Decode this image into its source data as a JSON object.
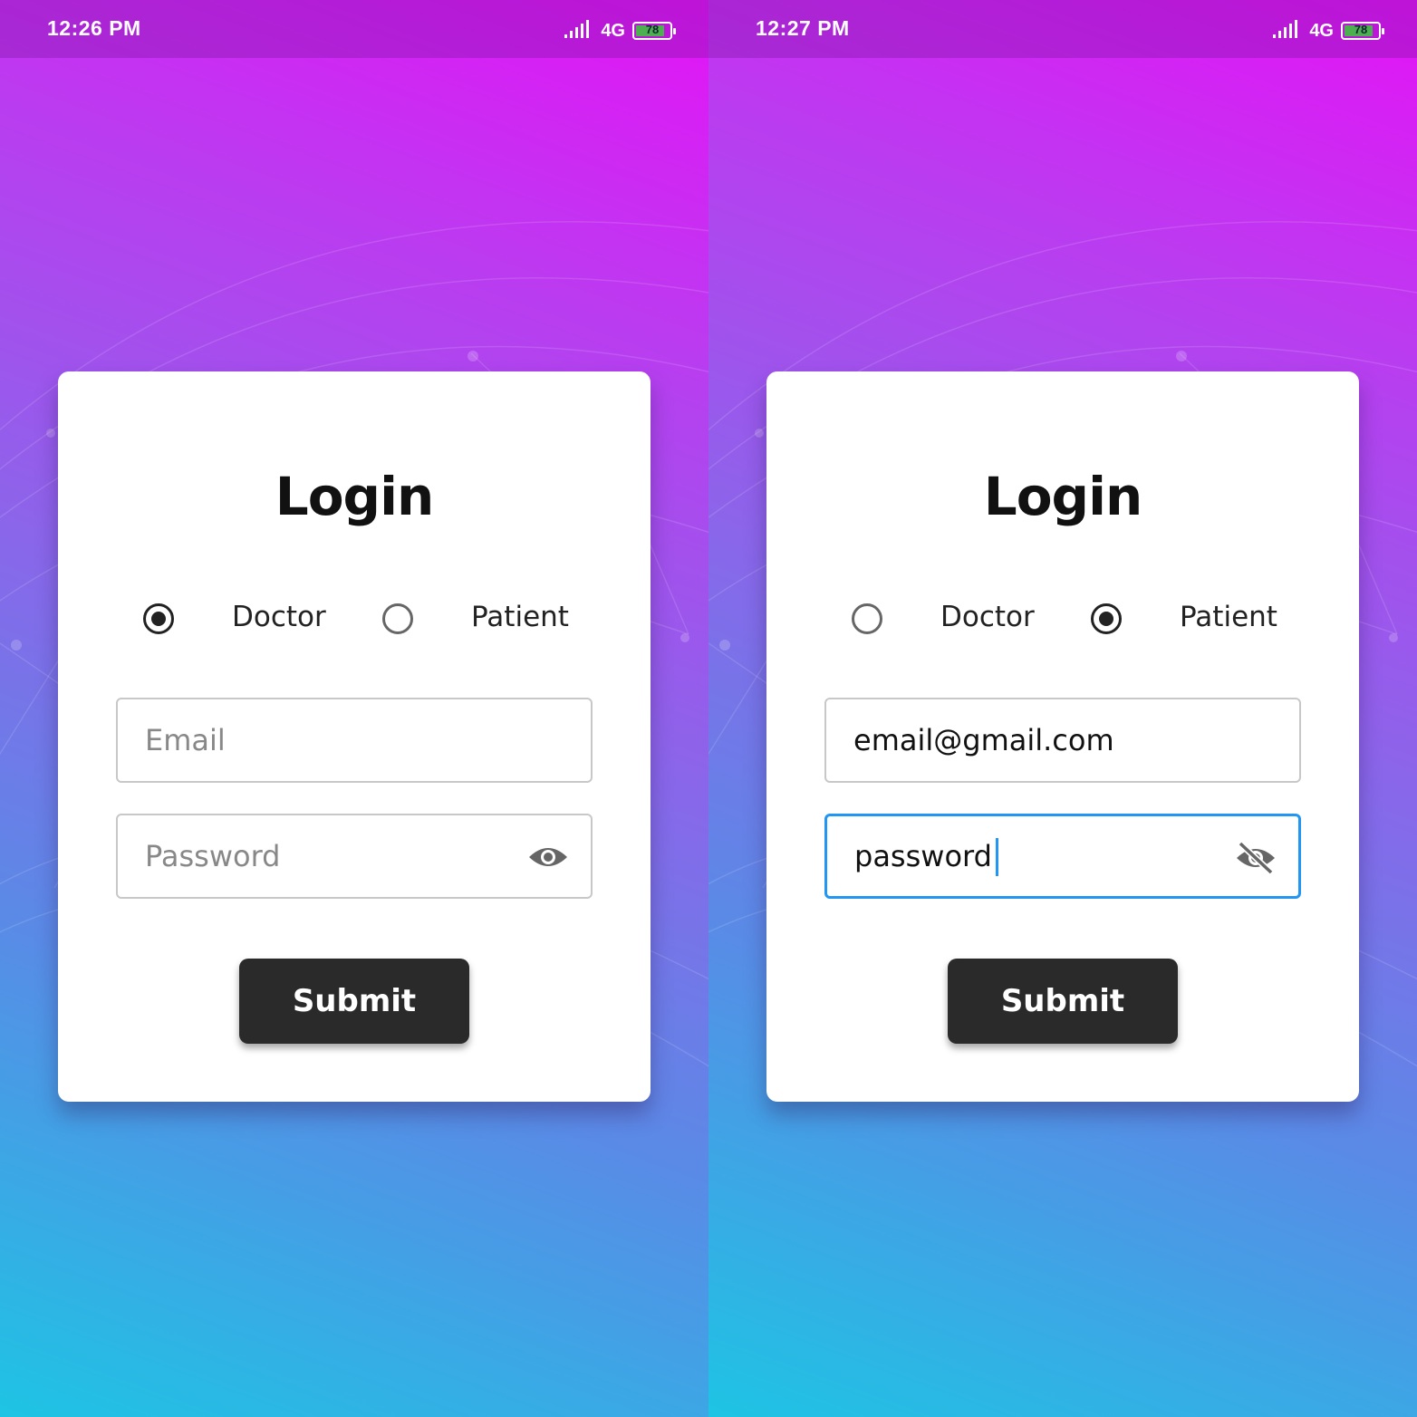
{
  "screens": [
    {
      "status": {
        "time": "12:26 PM",
        "network": "4G",
        "battery": "78",
        "battery_level": 0.78
      },
      "login": {
        "title": "Login",
        "role_options": [
          "Doctor",
          "Patient"
        ],
        "selected_role": "Doctor",
        "email": {
          "value": "",
          "placeholder": "Email"
        },
        "password": {
          "value": "",
          "placeholder": "Password",
          "visibility_icon": "eye-icon"
        },
        "submit_label": "Submit"
      }
    },
    {
      "status": {
        "time": "12:27 PM",
        "network": "4G",
        "battery": "78",
        "battery_level": 0.78
      },
      "login": {
        "title": "Login",
        "role_options": [
          "Doctor",
          "Patient"
        ],
        "selected_role": "Patient",
        "email": {
          "value": "email@gmail.com",
          "placeholder": "Email"
        },
        "password": {
          "value": "password",
          "placeholder": "Password",
          "visibility_icon": "eye-off-icon"
        },
        "submit_label": "Submit"
      }
    }
  ],
  "colors": {
    "accent": "#2196f3",
    "button": "#2a2a2a",
    "card": "#ffffff"
  }
}
